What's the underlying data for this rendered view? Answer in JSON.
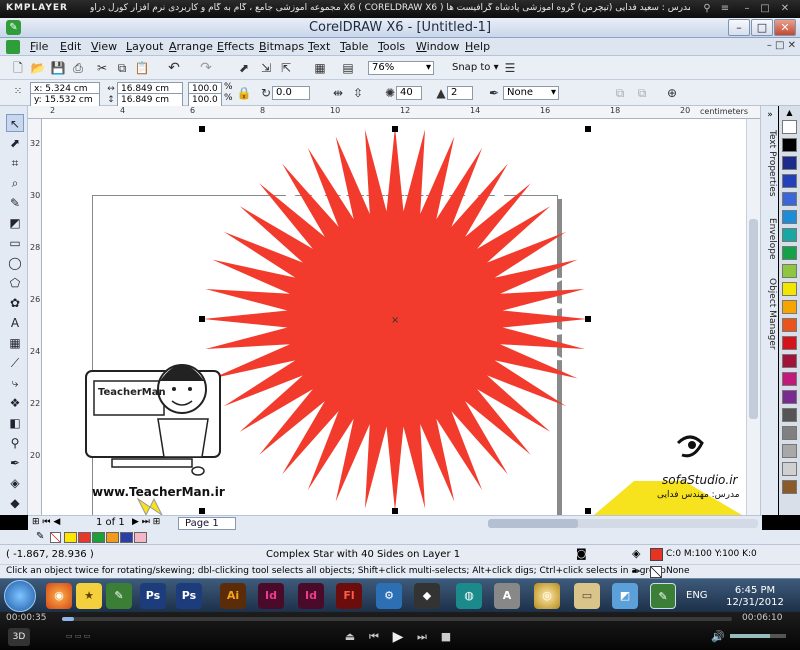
{
  "player": {
    "logo": "KMPLAYER",
    "title": "مجموعه آموزشی جامع ، گام به گام و کاربردی نرم افزار کورل دراو X6 ( CORELDRAW X6 ) مدرس : سعید فدایی (تیچرمن) گروه آموزشی پادشاه گرافیست ها",
    "time_elapsed": "00:00:35",
    "time_total": "00:06:10"
  },
  "app": {
    "title": "CorelDRAW X6 - [Untitled-1]"
  },
  "menu": {
    "items": [
      {
        "underline": "F",
        "rest": "ile"
      },
      {
        "underline": "E",
        "rest": "dit"
      },
      {
        "underline": "V",
        "rest": "iew"
      },
      {
        "underline": "L",
        "rest": "ayout"
      },
      {
        "underline": "A",
        "rest": "rrange"
      },
      {
        "underline": "E",
        "rest": "ffects"
      },
      {
        "underline": "B",
        "rest": "itmaps"
      },
      {
        "underline": "T",
        "rest": "ext"
      },
      {
        "underline": "T",
        "rest": "able"
      },
      {
        "underline": "T",
        "rest": "ools"
      },
      {
        "underline": "W",
        "rest": "indow"
      },
      {
        "underline": "H",
        "rest": "elp"
      }
    ]
  },
  "toolbar": {
    "zoom": "76%",
    "snap_to": "Snap to"
  },
  "property_bar": {
    "x": "x: 5.324 cm",
    "y": "y: 15.532 cm",
    "width": "16.849 cm",
    "height": "16.849 cm",
    "scale_x": "100.0",
    "scale_y": "100.0",
    "percent": "%",
    "rotation": "0.0",
    "points": "40",
    "sharpness": "2",
    "outline": "None"
  },
  "ruler": {
    "unit": "centimeters",
    "top_ticks": [
      "2",
      "4",
      "6",
      "8",
      "10",
      "12",
      "14",
      "16",
      "18",
      "20"
    ],
    "left_ticks": [
      "32",
      "30",
      "28",
      "26",
      "24",
      "22",
      "20"
    ]
  },
  "dockers": {
    "tabs": [
      "Text Properties",
      "Envelope",
      "Object Manager"
    ]
  },
  "palette": {
    "colors": [
      "#ffffff",
      "#000000",
      "#1b2c8a",
      "#2340b8",
      "#3a66d8",
      "#1e8cd6",
      "#1aa7a1",
      "#15a14a",
      "#8fc63f",
      "#f2e500",
      "#f6a500",
      "#e8541b",
      "#d4141c",
      "#a0143a",
      "#c21a7a",
      "#7a2b90",
      "#555555",
      "#808080",
      "#a8a8a8",
      "#d0d0d0",
      "#8b5a2b"
    ]
  },
  "pages": {
    "counter": "1 of 1",
    "current_tab": "Page 1"
  },
  "doc_palette": {
    "colors": [
      "#ffe600",
      "#e53a2b",
      "#1f9f3a",
      "#f29a1a",
      "#2a3ea6",
      "#f4b7c8"
    ]
  },
  "status": {
    "coords": "( -1.867, 28.936 )",
    "object_info": "Complex Star with 40 Sides on Layer 1",
    "fill": "C:0 M:100 Y:100 K:0",
    "fill_color": "#e53324",
    "outline": "None",
    "hint": "Click an object twice for rotating/skewing; dbl-clicking tool selects all objects; Shift+click multi-selects; Alt+click digs; Ctrl+click selects in a group"
  },
  "canvas_art": {
    "star_color": "#f23b2c",
    "teacher_site": "www.TeacherMan.ir",
    "teacher_logo": "TeacherMan",
    "studio": "sofaStudio.ir",
    "studio_credit": "مدرس: مهندس فدایی"
  },
  "taskbar": {
    "apps": [
      "Ps",
      "Ps",
      "Ai",
      "Id",
      "Id",
      "Fl"
    ],
    "language": "ENG",
    "time": "6:45 PM",
    "date": "12/31/2012"
  }
}
